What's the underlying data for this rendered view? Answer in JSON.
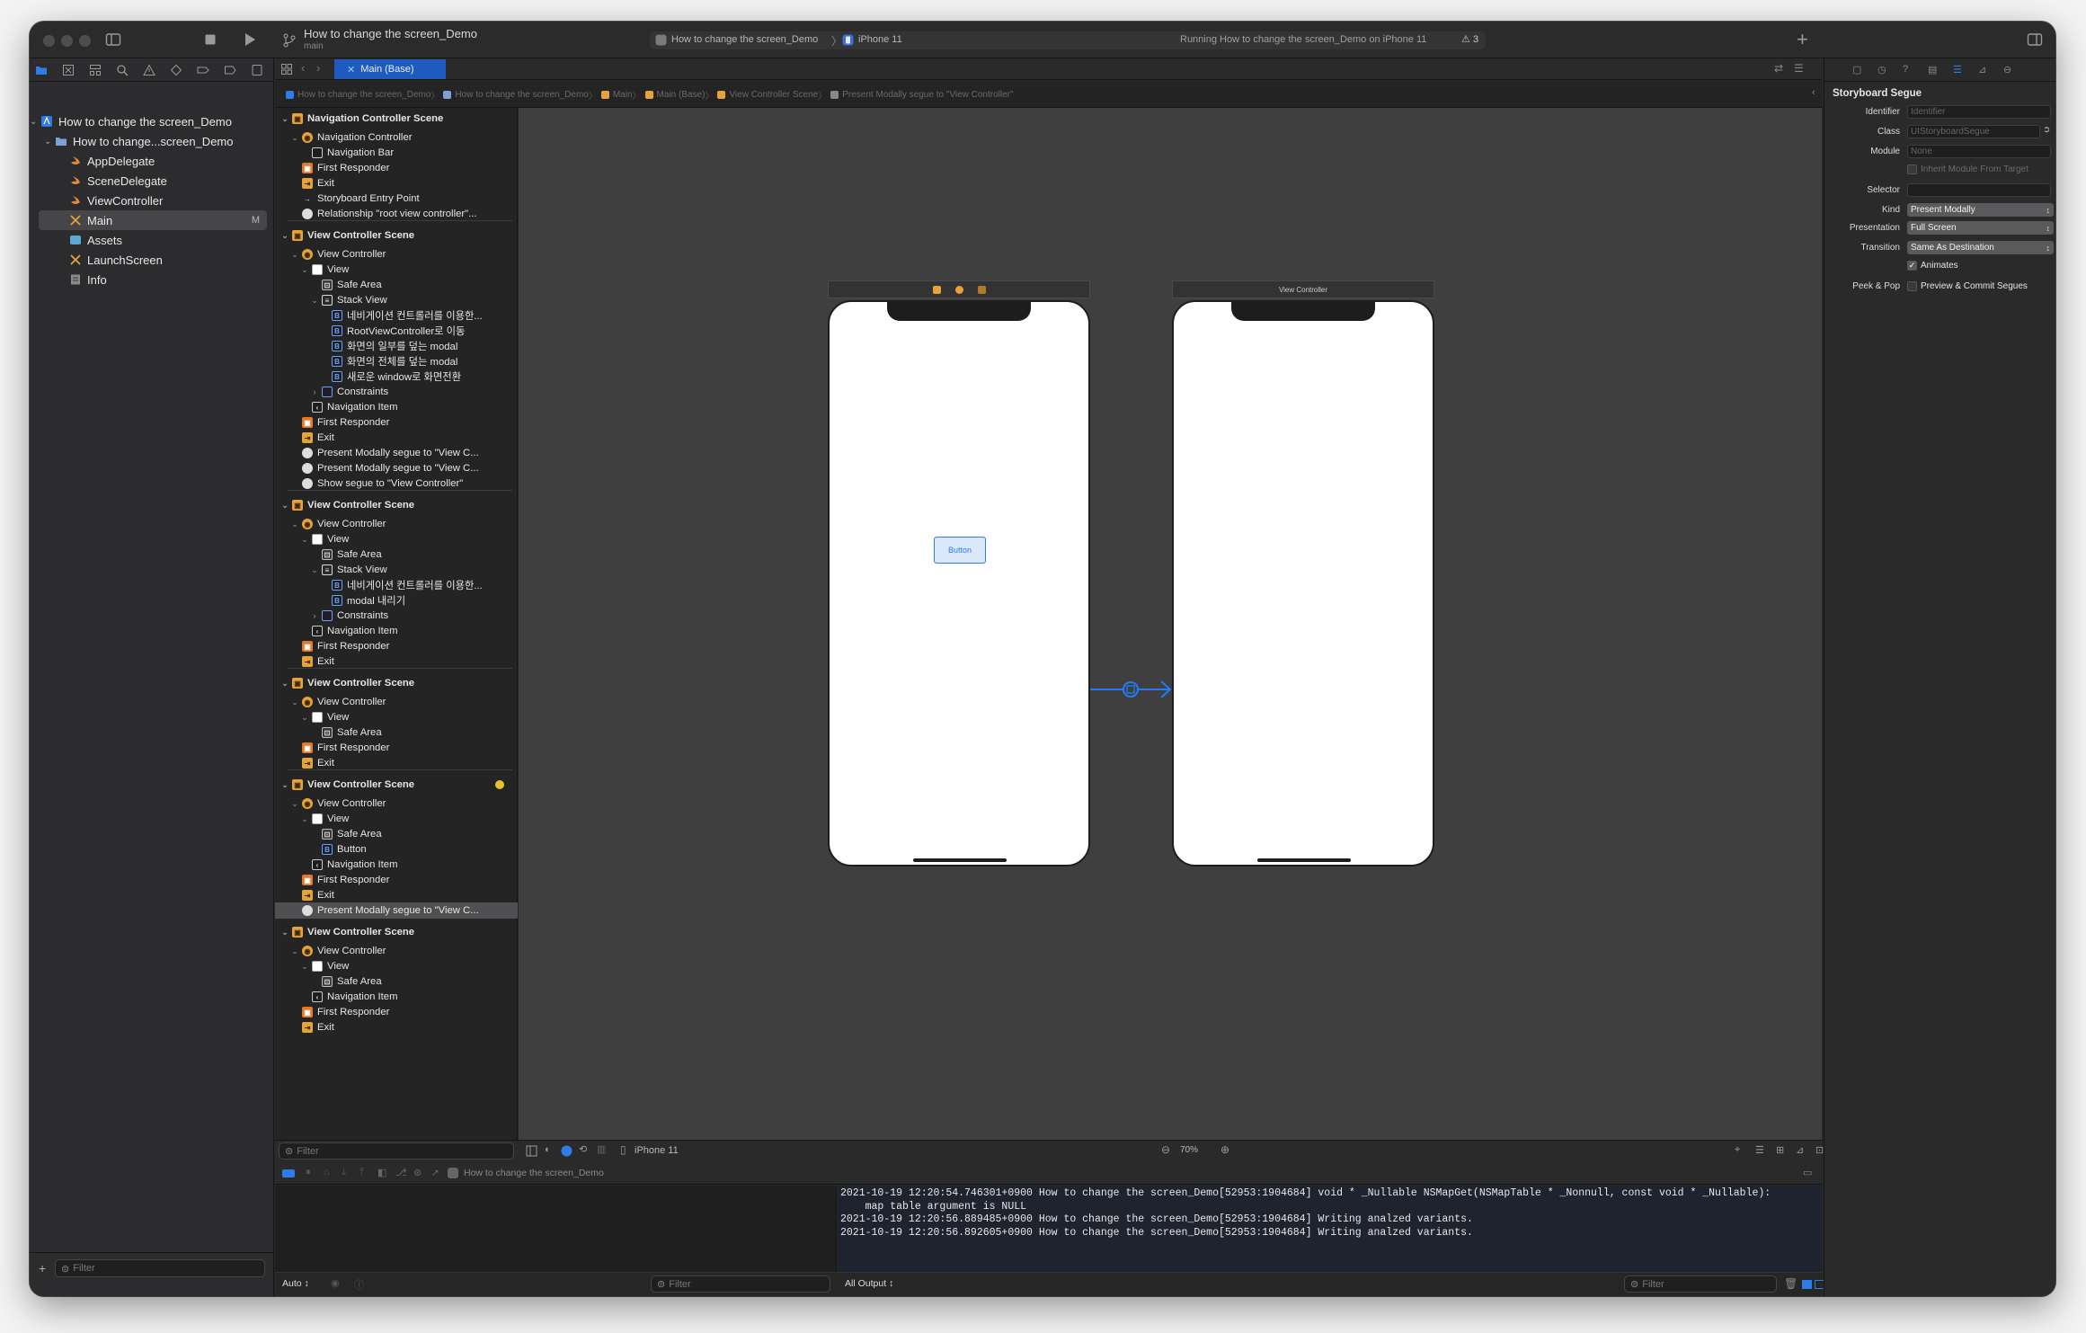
{
  "titlebar": {
    "project_title": "How to change the screen_Demo",
    "branch": "main",
    "scheme": "How to change the screen_Demo",
    "device": "iPhone 11",
    "status": "Running How to change the screen_Demo on iPhone 11",
    "warning_count": "3",
    "add": "+"
  },
  "tab": {
    "label": "Main (Base)"
  },
  "jumpbar": [
    "How to change the screen_Demo",
    "How to change the screen_Demo",
    "Main",
    "Main (Base)",
    "View Controller Scene",
    "Present Modally segue to \"View Controller\""
  ],
  "navigator": {
    "items": [
      {
        "label": "How to change the screen_Demo"
      },
      {
        "label": "How to change...screen_Demo"
      },
      {
        "label": "AppDelegate"
      },
      {
        "label": "SceneDelegate"
      },
      {
        "label": "ViewController"
      },
      {
        "label": "Main",
        "badge": "M"
      },
      {
        "label": "Assets"
      },
      {
        "label": "LaunchScreen"
      },
      {
        "label": "Info"
      }
    ],
    "filter_placeholder": "Filter"
  },
  "outline": {
    "rows": [
      {
        "label": "Navigation Controller Scene"
      },
      {
        "label": "Navigation Controller"
      },
      {
        "label": "Navigation Bar"
      },
      {
        "label": "First Responder"
      },
      {
        "label": "Exit"
      },
      {
        "label": "Storyboard Entry Point"
      },
      {
        "label": "Relationship \"root view controller\"..."
      },
      {
        "label": "View Controller Scene"
      },
      {
        "label": "View Controller"
      },
      {
        "label": "View"
      },
      {
        "label": "Safe Area"
      },
      {
        "label": "Stack View"
      },
      {
        "label": "네비게이션 컨트롤러를 이용한..."
      },
      {
        "label": "RootViewController로 이동"
      },
      {
        "label": "화면의 일부를 덮는 modal"
      },
      {
        "label": "화면의 전체를 덮는 modal"
      },
      {
        "label": "새로운 window로 화면전환"
      },
      {
        "label": "Constraints"
      },
      {
        "label": "Navigation Item"
      },
      {
        "label": "First Responder"
      },
      {
        "label": "Exit"
      },
      {
        "label": "Present Modally segue to \"View C..."
      },
      {
        "label": "Present Modally segue to \"View C..."
      },
      {
        "label": "Show segue to \"View Controller\""
      },
      {
        "label": "View Controller Scene"
      },
      {
        "label": "View Controller"
      },
      {
        "label": "View"
      },
      {
        "label": "Safe Area"
      },
      {
        "label": "Stack View"
      },
      {
        "label": "네비게이션 컨트롤러를 이용한..."
      },
      {
        "label": "modal 내리기"
      },
      {
        "label": "Constraints"
      },
      {
        "label": "Navigation Item"
      },
      {
        "label": "First Responder"
      },
      {
        "label": "Exit"
      },
      {
        "label": "View Controller Scene"
      },
      {
        "label": "View Controller"
      },
      {
        "label": "View"
      },
      {
        "label": "Safe Area"
      },
      {
        "label": "First Responder"
      },
      {
        "label": "Exit"
      },
      {
        "label": "View Controller Scene"
      },
      {
        "label": "View Controller"
      },
      {
        "label": "View"
      },
      {
        "label": "Safe Area"
      },
      {
        "label": "Button"
      },
      {
        "label": "Navigation Item"
      },
      {
        "label": "First Responder"
      },
      {
        "label": "Exit"
      },
      {
        "label": "Present Modally segue to \"View C..."
      },
      {
        "label": "View Controller Scene"
      },
      {
        "label": "View Controller"
      },
      {
        "label": "View"
      },
      {
        "label": "Safe Area"
      },
      {
        "label": "Navigation Item"
      },
      {
        "label": "First Responder"
      },
      {
        "label": "Exit"
      }
    ],
    "filter_placeholder": "Filter"
  },
  "canvas": {
    "button_label": "Button",
    "right_scene_title": "View Controller",
    "device": "iPhone 11",
    "zoom": "70%"
  },
  "debug": {
    "process": "How to change the screen_Demo",
    "log": [
      "2021-10-19 12:20:54.746301+0900 How to change the screen_Demo[52953:1904684] void * _Nullable NSMapGet(NSMapTable * _Nonnull, const void * _Nullable):",
      "    map table argument is NULL",
      "2021-10-19 12:20:56.889485+0900 How to change the screen_Demo[52953:1904684] Writing analzed variants.",
      "2021-10-19 12:20:56.892605+0900 How to change the screen_Demo[52953:1904684] Writing analzed variants."
    ],
    "auto": "Auto ↕",
    "filter_placeholder": "Filter",
    "all_output": "All Output ↕",
    "filter2_placeholder": "Filter"
  },
  "inspector": {
    "title": "Storyboard Segue",
    "identifier_label": "Identifier",
    "identifier_placeholder": "Identifier",
    "class_label": "Class",
    "class_value": "UIStoryboardSegue",
    "module_label": "Module",
    "module_value": "None",
    "inherit": "Inherit Module From Target",
    "selector_label": "Selector",
    "kind_label": "Kind",
    "kind_value": "Present Modally",
    "presentation_label": "Presentation",
    "presentation_value": "Full Screen",
    "transition_label": "Transition",
    "transition_value": "Same As Destination",
    "animates": "Animates",
    "peek_label": "Peek & Pop",
    "peek_value": "Preview & Commit Segues"
  },
  "colors": {
    "accent": "#2f7ce9",
    "storyboard_icon": "#e7a33b",
    "segue_line": "#1f7cff"
  }
}
